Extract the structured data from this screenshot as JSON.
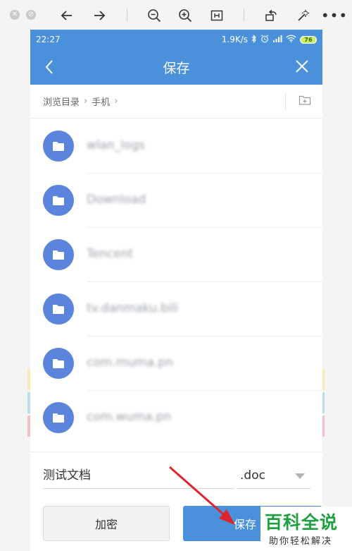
{
  "viewer": {
    "icons": [
      "close-circle-icon",
      "block-icon",
      "arrow-left-icon",
      "arrow-right-icon",
      "zoom-out-icon",
      "zoom-in-icon",
      "fit-icon",
      "rotate-icon",
      "magic-wand-icon",
      "more-icon"
    ]
  },
  "status_bar": {
    "time": "22:27",
    "network_speed": "1.9K/s",
    "battery": "76"
  },
  "header": {
    "title": "保存"
  },
  "breadcrumb": {
    "items": [
      "浏览目录",
      "手机"
    ]
  },
  "folders": [
    {
      "name": "wlan_logs"
    },
    {
      "name": "Download"
    },
    {
      "name": "Tencent"
    },
    {
      "name": "tv.danmaku.bili"
    },
    {
      "name": "com.muma.pn"
    },
    {
      "name": "com.wuma.pn"
    }
  ],
  "form": {
    "filename": "测试文档",
    "extension": ".doc"
  },
  "buttons": {
    "encrypt_label": "加密",
    "save_label": "保存"
  },
  "watermark": {
    "title": "百科全说",
    "subtitle": "助你轻松解决"
  },
  "colors": {
    "accent": "#4b90da",
    "folder": "#5b84dc",
    "annotation_arrow": "#d9252b",
    "watermark_green": "#1fa040"
  }
}
